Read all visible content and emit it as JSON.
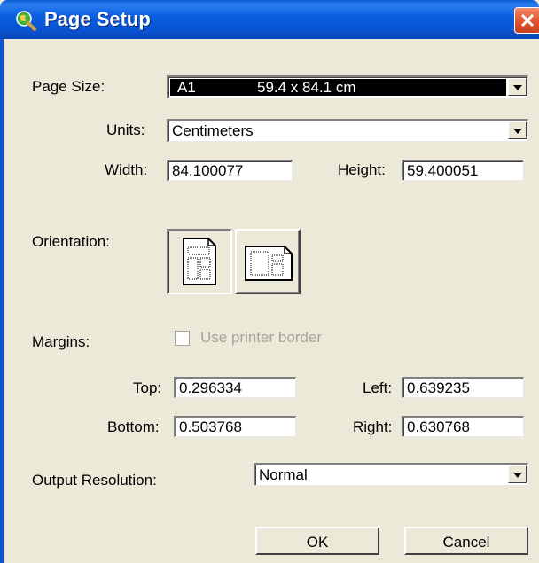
{
  "window": {
    "title": "Page Setup",
    "title_icon": "magnifier-globe-icon",
    "close_icon": "close-x-icon"
  },
  "page_size": {
    "label": "Page Size:",
    "selected_name": "A1",
    "selected_dims": "59.4 x 84.1 cm"
  },
  "units": {
    "label": "Units:",
    "value": "Centimeters"
  },
  "dimensions": {
    "width_label": "Width:",
    "width_value": "84.100077",
    "height_label": "Height:",
    "height_value": "59.400051"
  },
  "orientation": {
    "label": "Orientation:",
    "selected": "portrait",
    "options": [
      "portrait-icon",
      "landscape-icon"
    ]
  },
  "margins": {
    "label": "Margins:",
    "printer_border_label": "Use printer border",
    "printer_border_checked": false,
    "top_label": "Top:",
    "top_value": "0.296334",
    "left_label": "Left:",
    "left_value": "0.639235",
    "bottom_label": "Bottom:",
    "bottom_value": "0.503768",
    "right_label": "Right:",
    "right_value": "0.630768"
  },
  "output_resolution": {
    "label": "Output Resolution:",
    "value": "Normal"
  },
  "buttons": {
    "ok": "OK",
    "cancel": "Cancel"
  }
}
